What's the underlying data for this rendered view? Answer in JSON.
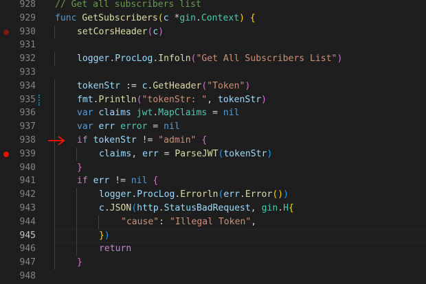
{
  "editor": {
    "colors": {
      "background": "#1e1e1e",
      "line_number": "#858585",
      "active_line_number": "#c6c6c6",
      "breakpoint": "#e51400",
      "arrow": "#e51400",
      "comment": "#6a9955",
      "keyword": "#569cd6",
      "function": "#dcdcaa",
      "variable": "#9cdcfe",
      "type": "#4ec9b0",
      "string": "#ce9178",
      "bracket_level_1": "#ffd700",
      "bracket_level_2": "#da70d6",
      "bracket_level_3": "#179fff"
    },
    "active_line": "945",
    "lines": [
      {
        "number": "928",
        "tokens": [
          [
            "cm",
            "// Get all subscribers list"
          ]
        ]
      },
      {
        "number": "929",
        "tokens": [
          [
            "kw",
            "func "
          ],
          [
            "fn",
            "GetSubscribers"
          ],
          [
            "b1",
            "("
          ],
          [
            "vr",
            "c"
          ],
          [
            "op",
            " *"
          ],
          [
            "ty",
            "gin"
          ],
          [
            "op",
            "."
          ],
          [
            "ty",
            "Context"
          ],
          [
            "b1",
            ")"
          ],
          [
            "op",
            " "
          ],
          [
            "b1",
            "{"
          ]
        ]
      },
      {
        "number": "930",
        "breakpoint": "dim",
        "indent": 1,
        "tokens": [
          [
            "fn",
            "setCorsHeader"
          ],
          [
            "b2",
            "("
          ],
          [
            "vr",
            "c"
          ],
          [
            "b2",
            ")"
          ]
        ]
      },
      {
        "number": "931",
        "tokens": []
      },
      {
        "number": "932",
        "indent": 1,
        "tokens": [
          [
            "vr",
            "logger"
          ],
          [
            "op",
            "."
          ],
          [
            "vr",
            "ProcLog"
          ],
          [
            "op",
            "."
          ],
          [
            "fn",
            "Infoln"
          ],
          [
            "b2",
            "("
          ],
          [
            "st",
            "\"Get All Subscribers List\""
          ],
          [
            "b2",
            ")"
          ]
        ]
      },
      {
        "number": "933",
        "tokens": []
      },
      {
        "number": "934",
        "indent": 1,
        "tokens": [
          [
            "vr",
            "tokenStr"
          ],
          [
            "op",
            " := "
          ],
          [
            "vr",
            "c"
          ],
          [
            "op",
            "."
          ],
          [
            "fn",
            "GetHeader"
          ],
          [
            "b2",
            "("
          ],
          [
            "st",
            "\"Token\""
          ],
          [
            "b2",
            ")"
          ]
        ]
      },
      {
        "number": "935",
        "modified": true,
        "indent": 1,
        "tokens": [
          [
            "vr",
            "fmt"
          ],
          [
            "op",
            "."
          ],
          [
            "fn",
            "Println"
          ],
          [
            "b2",
            "("
          ],
          [
            "st",
            "\"tokenStr: \""
          ],
          [
            "op",
            ", "
          ],
          [
            "vr",
            "tokenStr"
          ],
          [
            "b2",
            ")"
          ]
        ]
      },
      {
        "number": "936",
        "indent": 1,
        "tokens": [
          [
            "kw",
            "var "
          ],
          [
            "vr",
            "claims "
          ],
          [
            "ty",
            "jwt"
          ],
          [
            "op",
            "."
          ],
          [
            "ty",
            "MapClaims"
          ],
          [
            "op",
            " = "
          ],
          [
            "kw",
            "nil"
          ]
        ]
      },
      {
        "number": "937",
        "indent": 1,
        "tokens": [
          [
            "kw",
            "var "
          ],
          [
            "vr",
            "err "
          ],
          [
            "ty",
            "error"
          ],
          [
            "op",
            " = "
          ],
          [
            "kw",
            "nil"
          ]
        ]
      },
      {
        "number": "938",
        "arrow": true,
        "indent": 1,
        "tokens": [
          [
            "ct",
            "if "
          ],
          [
            "vr",
            "tokenStr"
          ],
          [
            "op",
            " != "
          ],
          [
            "st",
            "\"admin\""
          ],
          [
            "op",
            " "
          ],
          [
            "b2",
            "{"
          ]
        ]
      },
      {
        "number": "939",
        "breakpoint": "bright",
        "indent": 2,
        "tokens": [
          [
            "vr",
            "claims"
          ],
          [
            "op",
            ", "
          ],
          [
            "vr",
            "err"
          ],
          [
            "op",
            " = "
          ],
          [
            "fn",
            "ParseJWT"
          ],
          [
            "b3",
            "("
          ],
          [
            "vr",
            "tokenStr"
          ],
          [
            "b3",
            ")"
          ]
        ]
      },
      {
        "number": "940",
        "indent": 1,
        "tokens": [
          [
            "b2",
            "}"
          ]
        ]
      },
      {
        "number": "941",
        "indent": 1,
        "tokens": [
          [
            "ct",
            "if "
          ],
          [
            "vr",
            "err"
          ],
          [
            "op",
            " != "
          ],
          [
            "kw",
            "nil"
          ],
          [
            "op",
            " "
          ],
          [
            "b2",
            "{"
          ]
        ]
      },
      {
        "number": "942",
        "indent": 2,
        "tokens": [
          [
            "vr",
            "logger"
          ],
          [
            "op",
            "."
          ],
          [
            "vr",
            "ProcLog"
          ],
          [
            "op",
            "."
          ],
          [
            "fn",
            "Errorln"
          ],
          [
            "b3",
            "("
          ],
          [
            "vr",
            "err"
          ],
          [
            "op",
            "."
          ],
          [
            "fn",
            "Error"
          ],
          [
            "b1",
            "()"
          ],
          [
            "b3",
            ")"
          ]
        ]
      },
      {
        "number": "943",
        "indent": 2,
        "tokens": [
          [
            "vr",
            "c"
          ],
          [
            "op",
            "."
          ],
          [
            "fn",
            "JSON"
          ],
          [
            "b3",
            "("
          ],
          [
            "vr",
            "http"
          ],
          [
            "op",
            "."
          ],
          [
            "vr",
            "StatusBadRequest"
          ],
          [
            "op",
            ", "
          ],
          [
            "ty",
            "gin"
          ],
          [
            "op",
            "."
          ],
          [
            "ty",
            "H"
          ],
          [
            "b1",
            "{"
          ]
        ]
      },
      {
        "number": "944",
        "indent": 3,
        "tokens": [
          [
            "st",
            "\"cause\""
          ],
          [
            "op",
            ": "
          ],
          [
            "st",
            "\"Illegal Token\""
          ],
          [
            "op",
            ","
          ]
        ]
      },
      {
        "number": "945",
        "indent": 2,
        "tokens": [
          [
            "b1",
            "}"
          ],
          [
            "b3",
            ")"
          ]
        ]
      },
      {
        "number": "946",
        "indent": 2,
        "tokens": [
          [
            "ct",
            "return"
          ]
        ]
      },
      {
        "number": "947",
        "indent": 1,
        "tokens": [
          [
            "b2",
            "}"
          ]
        ]
      },
      {
        "number": "948",
        "tokens": []
      }
    ]
  }
}
